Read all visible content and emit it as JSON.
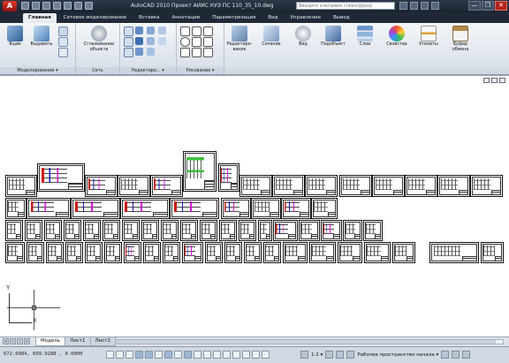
{
  "titlebar": {
    "app_letter": "A",
    "title": "AutoCAD 2010    Проект АИИС КУЭ ПС 110_35_10.dwg",
    "search_placeholder": "Введите ключевое слово/фразу",
    "controls": [
      "—",
      "❐",
      "✕"
    ]
  },
  "ribbon_tabs": [
    "Главная",
    "Сетевое моделирование",
    "Вставка",
    "Аннотации",
    "Параметризация",
    "Вид",
    "Управление",
    "Вывод"
  ],
  "ribbon": {
    "groups": [
      {
        "title": "Моделирование ▾"
      },
      {
        "title": "Сеть"
      },
      {
        "title": "Редактиро... ▾"
      },
      {
        "title": "Рисование ▾"
      },
      {
        "title": ""
      }
    ],
    "buttons": {
      "box": "Ящик",
      "extrude": "Выдавить",
      "smooth": "Сглаживание объекта",
      "edit_view": "Редактиро-вание",
      "section": "Сечение",
      "view": "Вид",
      "subobject": "Подобъект",
      "layers": "Слои",
      "properties": "Свойства",
      "utilities": "Утилиты",
      "clipboard": "Буфер обмена"
    }
  },
  "ucs": {
    "x": "X",
    "y": "Y"
  },
  "layout_tabs": [
    "Модель",
    "Лист1",
    "Лист2"
  ],
  "status": {
    "coords": "672.6984, 699.9288 , 0.0000",
    "scale": "1:1 ▾",
    "workspace": "Рабочее пространство начала ▾"
  }
}
